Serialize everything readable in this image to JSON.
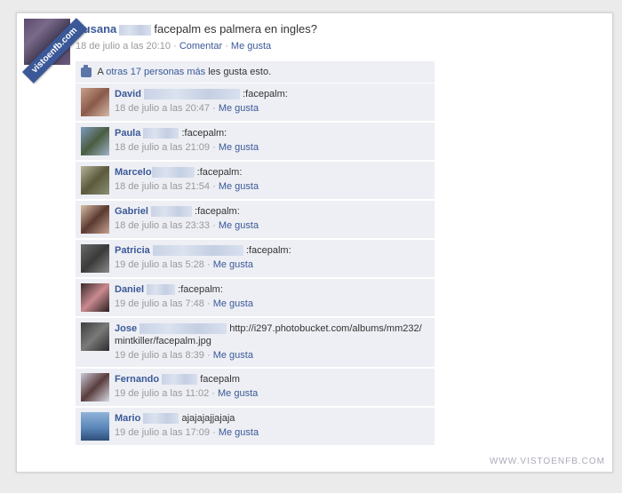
{
  "watermark_ribbon": "vistoenfb.com",
  "post": {
    "author": "Susana",
    "text": "facepalm es palmera en ingles?",
    "time": "18 de julio a las 20:10",
    "sep1": "·",
    "comment_link": "Comentar",
    "sep2": "·",
    "like_link": "Me gusta"
  },
  "likes": {
    "prefix": "A",
    "link": "otras 17 personas más",
    "suffix": "les gusta esto."
  },
  "comments": [
    {
      "author": "David",
      "text": ":facepalm:",
      "time": "18 de julio a las 20:47",
      "like": "Me gusta"
    },
    {
      "author": "Paula",
      "text": ":facepalm:",
      "time": "18 de julio a las 21:09",
      "like": "Me gusta"
    },
    {
      "author": "Marcelo",
      "text": ":facepalm:",
      "time": "18 de julio a las 21:54",
      "like": "Me gusta"
    },
    {
      "author": "Gabriel",
      "text": ":facepalm:",
      "time": "18 de julio a las 23:33",
      "like": "Me gusta"
    },
    {
      "author": "Patricia",
      "text": ":facepalm:",
      "time": "19 de julio a las 5:28",
      "like": "Me gusta"
    },
    {
      "author": "Daniel",
      "text": ":facepalm:",
      "time": "19 de julio a las 7:48",
      "like": "Me gusta"
    },
    {
      "author": "Jose",
      "text": "http://i297.photobucket.com/albums/mm232/mintkiller/facepalm.jpg",
      "time": "19 de julio a las 8:39",
      "like": "Me gusta"
    },
    {
      "author": "Fernando",
      "text": "facepalm",
      "time": "19 de julio a las 11:02",
      "like": "Me gusta"
    },
    {
      "author": "Mario",
      "text": "ajajajajjajaja",
      "time": "19 de julio a las 17:09",
      "like": "Me gusta"
    }
  ],
  "meta_separator": "·",
  "footer_watermark": "WWW.VISTOENFB.COM"
}
